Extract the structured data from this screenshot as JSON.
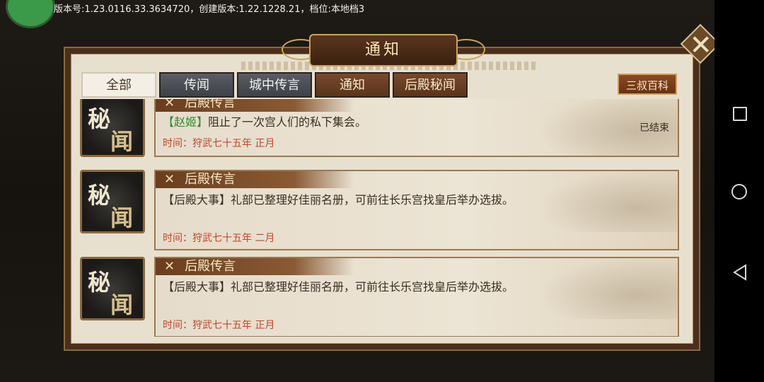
{
  "status_bar": {
    "version_text": "版本号:1.23.0116.33.3634720，创建版本:1.22.1228.21，档位:本地档3"
  },
  "dialog": {
    "title": "通知",
    "tabs": [
      {
        "label": "全部",
        "state": "active"
      },
      {
        "label": "传闻",
        "state": "inactive"
      },
      {
        "label": "城中传言",
        "state": "inactive"
      },
      {
        "label": "通知",
        "state": "inactive"
      },
      {
        "label": "后殿秘闻",
        "state": "inactive"
      }
    ],
    "wiki_label": "三叔百科",
    "items": [
      {
        "badge": [
          "秘",
          "闻"
        ],
        "header": "后殿传言",
        "name_tag": "【赵姬】",
        "message": "阻止了一次宫人们的私下集会。",
        "time": "时间：狩武七十五年 正月",
        "status": "已结束"
      },
      {
        "badge": [
          "秘",
          "闻"
        ],
        "header": "后殿传言",
        "name_tag": "",
        "message": "【后殿大事】礼部已整理好佳丽名册，可前往长乐宫找皇后举办选拔。",
        "time": "时间：狩武七十五年 二月",
        "status": ""
      },
      {
        "badge": [
          "秘",
          "闻"
        ],
        "header": "后殿传言",
        "name_tag": "",
        "message": "【后殿大事】礼部已整理好佳丽名册，可前往长乐宫找皇后举办选拔。",
        "time": "时间：狩武七十五年 正月",
        "status": ""
      }
    ]
  },
  "icons": {
    "close": "close-icon",
    "sword": "crossed-swords-icon",
    "nav_recent": "square-icon",
    "nav_home": "circle-icon",
    "nav_back": "triangle-back-icon"
  },
  "colors": {
    "frame": "#4a2f1c",
    "parchment": "#e8e0ce",
    "name_green": "#2e8a2e",
    "time_red": "#c2462c"
  }
}
